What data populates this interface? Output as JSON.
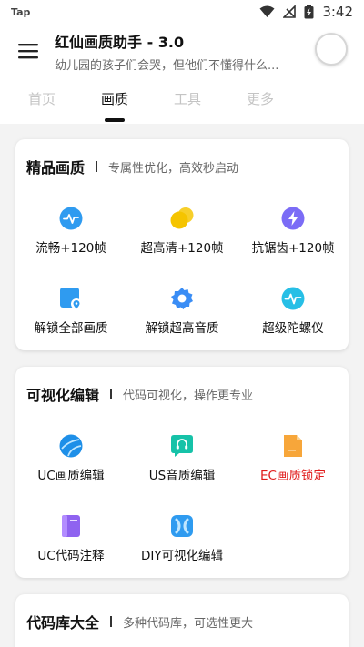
{
  "status_bar": {
    "carrier": "Tap",
    "time": "3:42"
  },
  "app_bar": {
    "title": "红仙画质助手 - 3.0",
    "subtitle": "幼儿园的孩子们会哭，但他们不懂得什么..."
  },
  "tabs": [
    {
      "label": "首页",
      "active": false
    },
    {
      "label": "画质",
      "active": true
    },
    {
      "label": "工具",
      "active": false
    },
    {
      "label": "更多",
      "active": false
    }
  ],
  "cards": [
    {
      "title": "精品画质",
      "desc": "专属性优化，高效秒启动",
      "items": [
        {
          "label": "流畅+120帧",
          "icon": "pulse-icon",
          "color": "#2f9bf0"
        },
        {
          "label": "超高清+120帧",
          "icon": "coins-icon",
          "color": "#f5c400"
        },
        {
          "label": "抗锯齿+120帧",
          "icon": "lightning-icon",
          "color": "#7b6cf6"
        },
        {
          "label": "解锁全部画质",
          "icon": "location-square-icon",
          "color": "#2f9bf0"
        },
        {
          "label": "解锁超高音质",
          "icon": "gear-icon",
          "color": "#3a8df5"
        },
        {
          "label": "超级陀螺仪",
          "icon": "pulse-icon",
          "color": "#27bfe6"
        }
      ]
    },
    {
      "title": "可视化编辑",
      "desc": "代码可视化，操作更专业",
      "items": [
        {
          "label": "UC画质编辑",
          "icon": "ball-icon",
          "color": "#1e8fe8"
        },
        {
          "label": "US音质编辑",
          "icon": "headphone-chat-icon",
          "color": "#16c2a8"
        },
        {
          "label": "EC画质锁定",
          "icon": "file-icon",
          "color": "#f7a63a",
          "highlight": "#e01a1a"
        },
        {
          "label": "UC代码注释",
          "icon": "book-icon",
          "color": "#8f63f0"
        },
        {
          "label": "DIY可视化编辑",
          "icon": "x-shape-icon",
          "color": "#2f9bf0"
        }
      ]
    },
    {
      "title": "代码库大全",
      "desc": "多种代码库，可选性更大",
      "items": []
    }
  ]
}
